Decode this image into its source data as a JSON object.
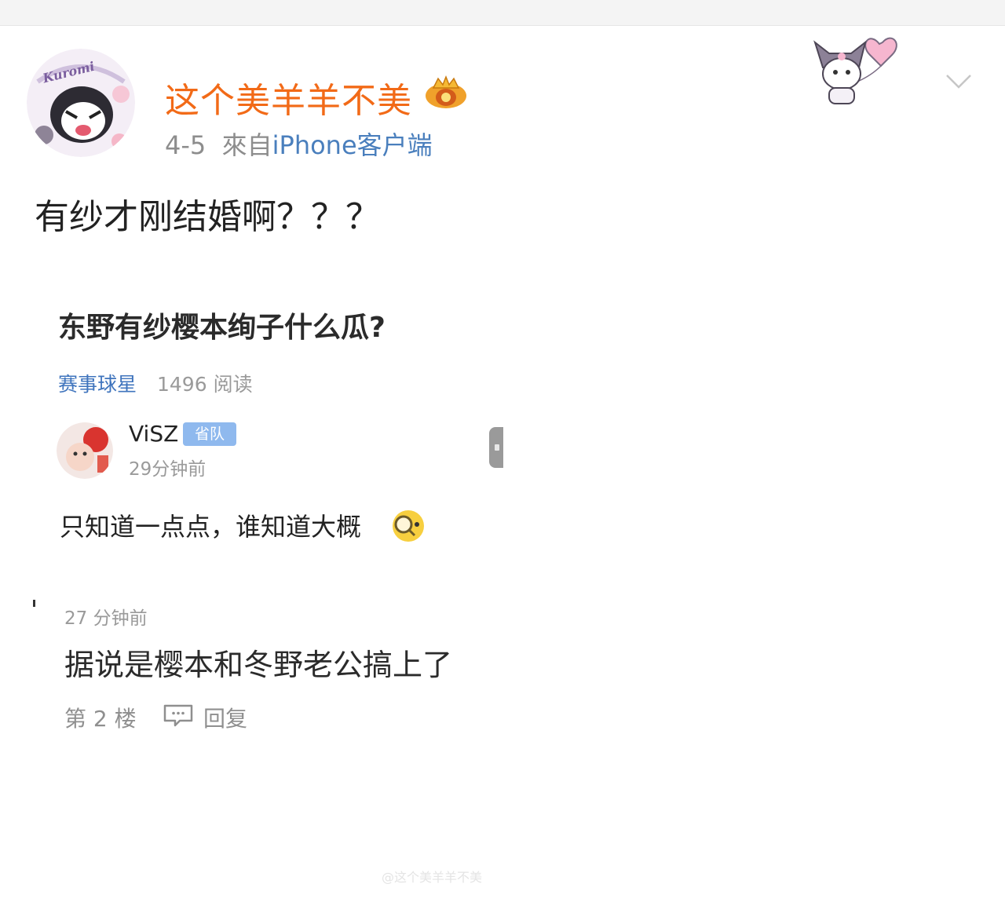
{
  "post": {
    "username": "这个美羊羊不美",
    "date": "4-5",
    "source_prefix": "來自",
    "source": "iPhone客户端",
    "text": "有纱才刚结婚啊？？？",
    "avatar_text": "Kuromi",
    "watermark": "@这个美羊羊不美"
  },
  "embedded": {
    "title": "东野有纱樱本绚子什么瓜?",
    "category": "赛事球星",
    "reads": "1496 阅读",
    "comment": {
      "author": "ViSZ",
      "badge": "省队",
      "time": "29分钟前",
      "text": "只知道一点点，谁知道大概"
    },
    "reply": {
      "time": "27 分钟前",
      "text": "据说是樱本和冬野老公搞上了",
      "floor": "第 2 楼",
      "reply_label": "回复"
    }
  },
  "icons": {
    "more": "chevron-down-icon",
    "reply": "comment-bubble-icon",
    "crown": "crown-badge-icon"
  },
  "colors": {
    "username": "#f26a17",
    "source_link": "#4a7fbd",
    "category": "#3f74bd",
    "badge": "#8fb9ee"
  }
}
